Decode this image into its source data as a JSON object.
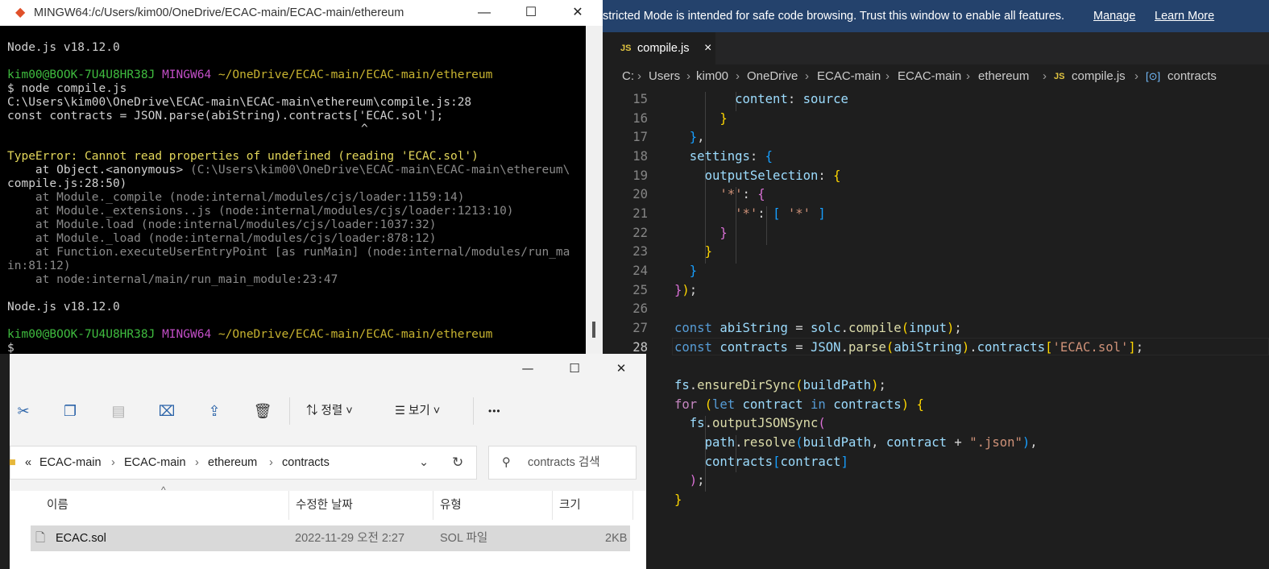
{
  "vscode": {
    "banner": {
      "message": "stricted Mode is intended for safe code browsing. Trust this window to enable all features.",
      "manage_link": "Manage",
      "learn_link": "Learn More"
    },
    "tab": {
      "icon": "JS",
      "name": "compile.js",
      "close": "×"
    },
    "breadcrumb": [
      "C:",
      "Users",
      "kim00",
      "OneDrive",
      "ECAC-main",
      "ECAC-main",
      "ethereum",
      "compile.js",
      "contracts"
    ],
    "breadcrumb_icons": {
      "js": "JS",
      "symbol": "[⊙]"
    },
    "line_numbers": [
      "15",
      "16",
      "17",
      "18",
      "19",
      "20",
      "21",
      "22",
      "23",
      "24",
      "25",
      "26",
      "27",
      "28"
    ],
    "cursor_line": "28"
  },
  "terminal": {
    "title": "MINGW64:/c/Users/kim00/OneDrive/ECAC-main/ECAC-main/ethereum",
    "lines": {
      "l1": "Node.js v18.12.0",
      "user": "kim00@BOOK-7U4U8HR38J",
      "mingw": "MINGW64",
      "path": "~/OneDrive/ECAC-main/ECAC-main/ethereum",
      "cmd": "$ node compile.js",
      "file": "C:\\Users\\kim00\\OneDrive\\ECAC-main\\ECAC-main\\ethereum\\compile.js:28",
      "src": "const contracts = JSON.parse(abiString).contracts['ECAC.sol'];",
      "caret": "^",
      "err": "TypeError: Cannot read properties of undefined (reading 'ECAC.sol')",
      "at1a": "    at Object.<anonymous> ",
      "at1b": "(C:\\Users\\kim00\\OneDrive\\ECAC-main\\ECAC-main\\ethereum\\",
      "at1c": "compile.js:28:50)",
      "at2": "    at Module._compile (node:internal/modules/cjs/loader:1159:14)",
      "at3": "    at Module._extensions..js (node:internal/modules/cjs/loader:1213:10)",
      "at4": "    at Module.load (node:internal/modules/cjs/loader:1037:32)",
      "at5": "    at Module._load (node:internal/modules/cjs/loader:878:12)",
      "at6": "    at Function.executeUserEntryPoint [as runMain] (node:internal/modules/run_ma",
      "at6b": "in:81:12)",
      "at7": "    at node:internal/main/run_main_module:23:47",
      "prompt": "$ "
    }
  },
  "explorer": {
    "toolbar": {
      "sort": "정렬",
      "view": "보기",
      "more": "•••"
    },
    "address": [
      "«",
      "ECAC-main",
      "ECAC-main",
      "ethereum",
      "contracts"
    ],
    "search_placeholder": "contracts 검색",
    "columns": [
      "이름",
      "수정한 날짜",
      "유형",
      "크기"
    ],
    "files": [
      {
        "name": "ECAC.sol",
        "modified": "2022-11-29 오전 2:27",
        "type": "SOL 파일",
        "size": "2KB"
      }
    ]
  }
}
